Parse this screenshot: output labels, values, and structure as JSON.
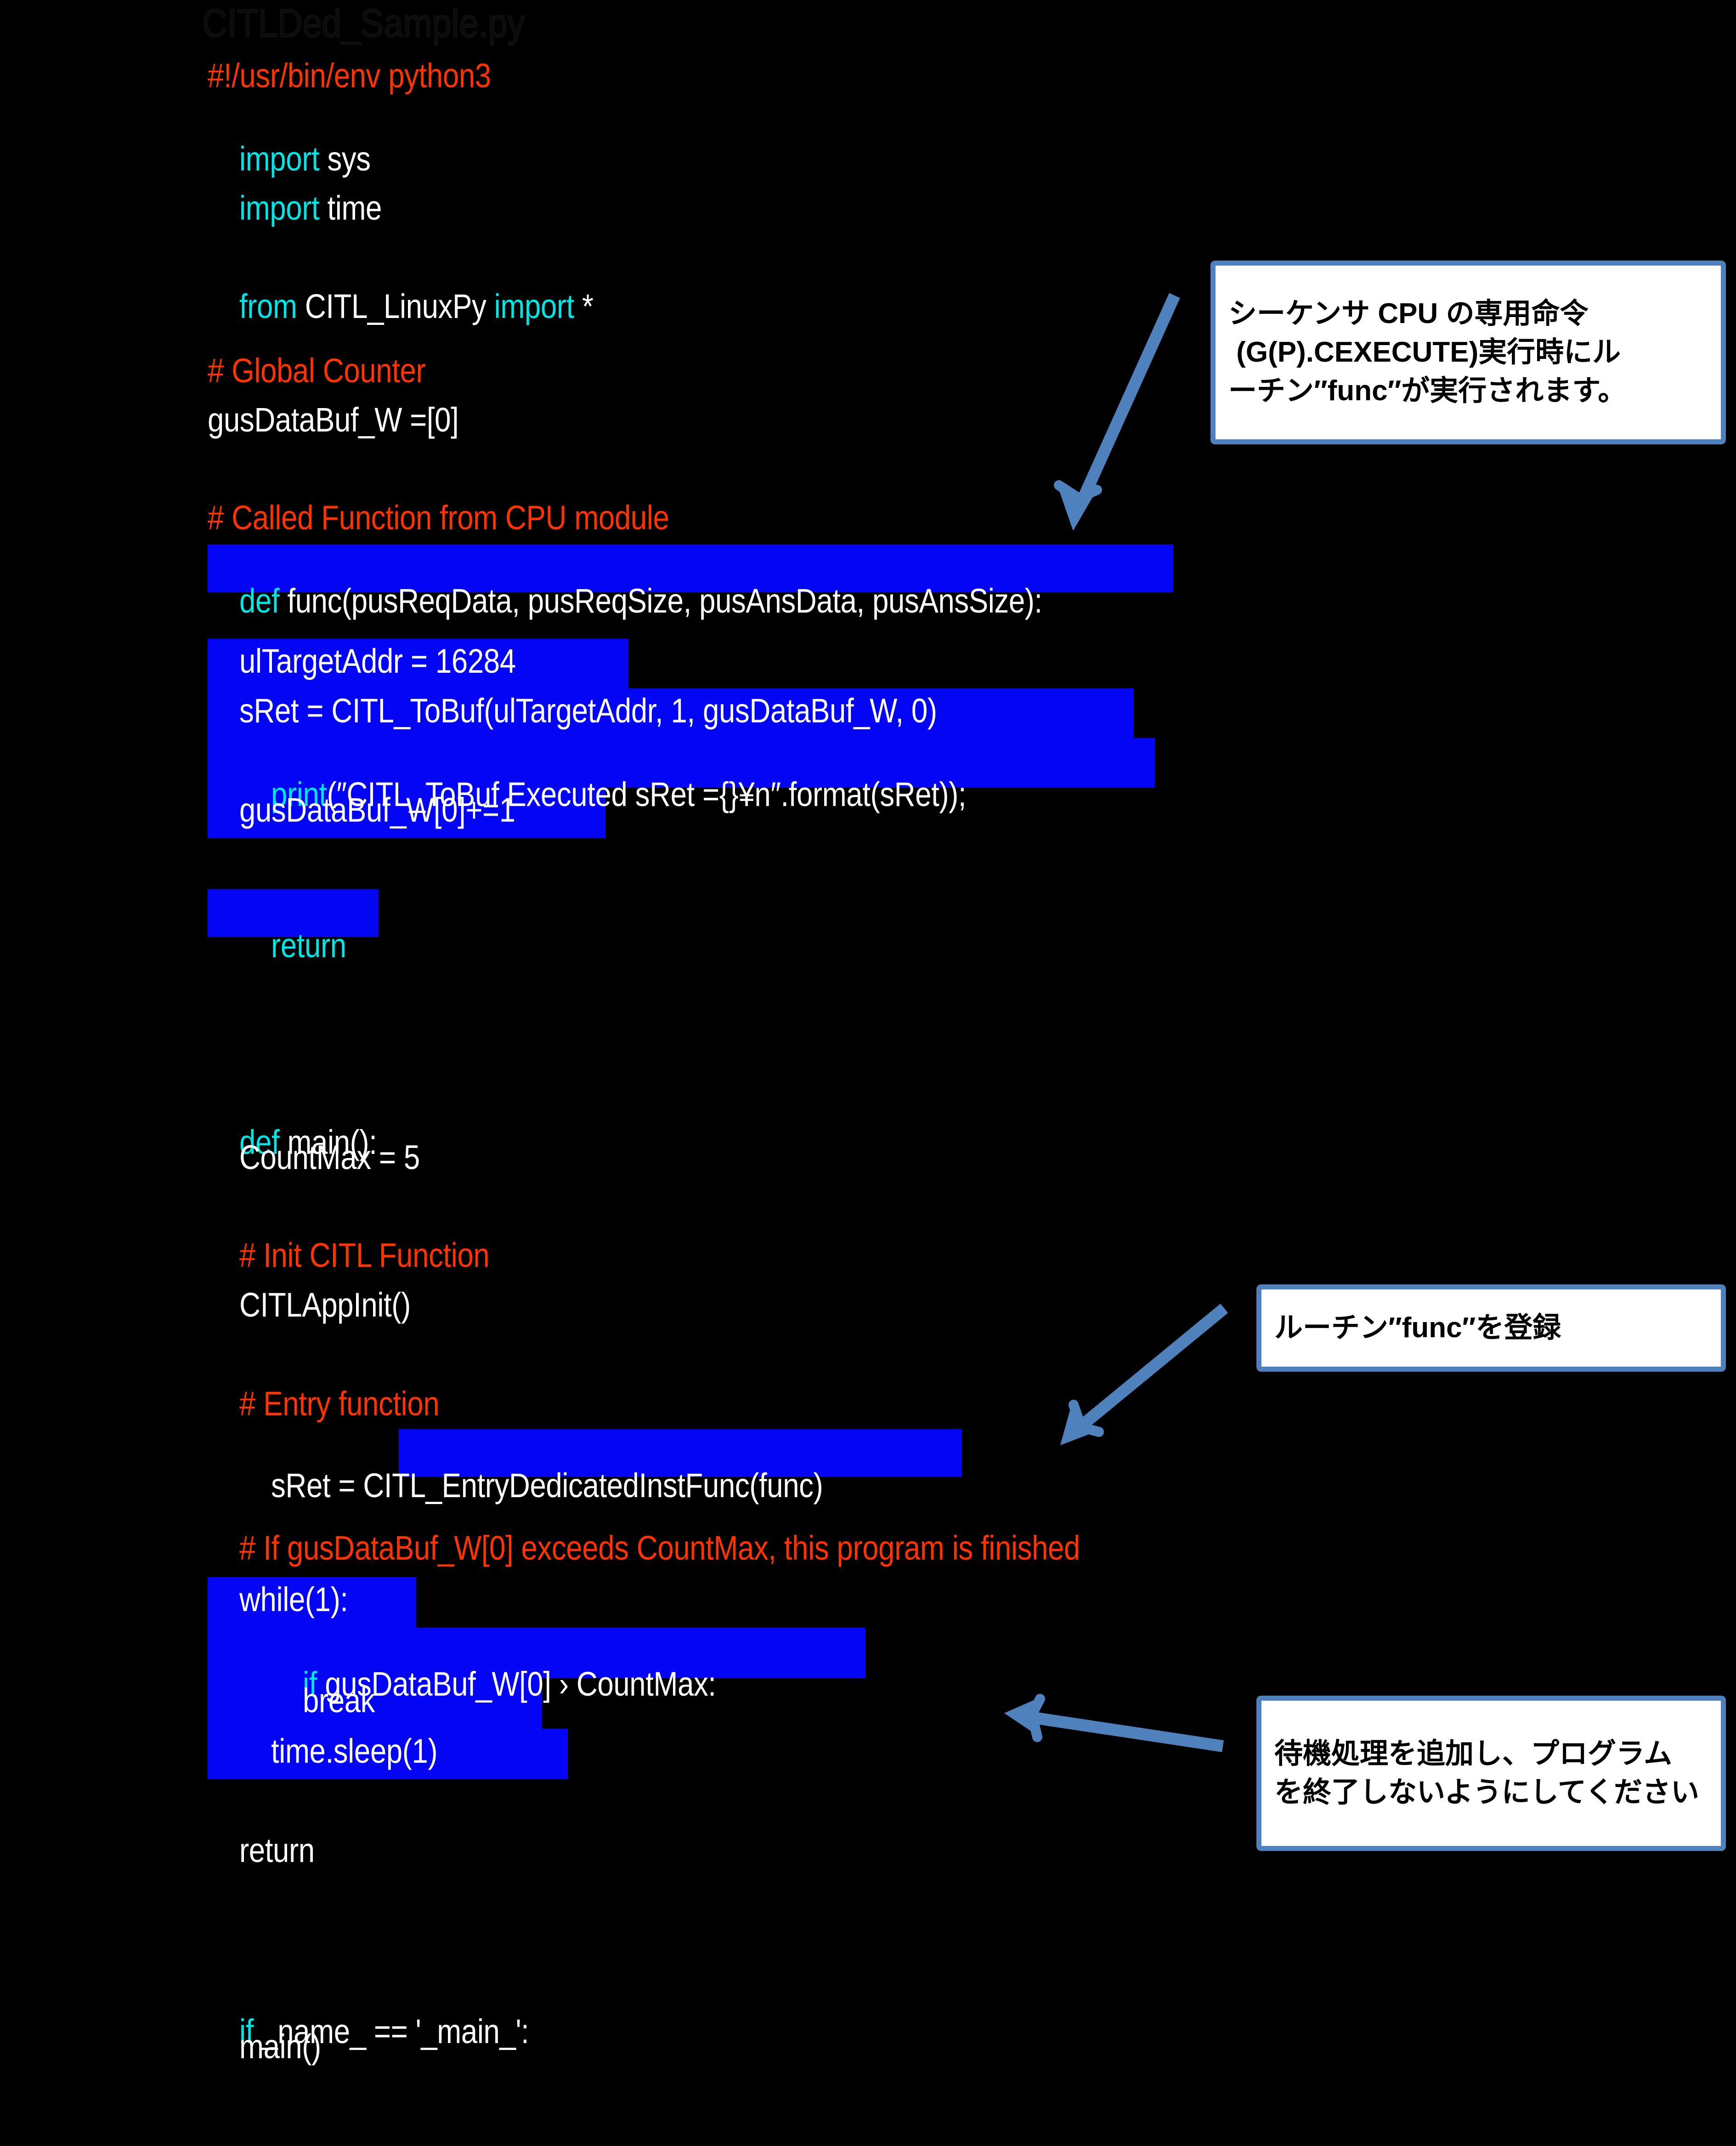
{
  "document": {
    "file_title": "CITLDed_Sample.py",
    "background_color": "#000000",
    "highlight_color": "#0505F5",
    "keyword_color": "#00E5E5",
    "comment_color": "#FF3300",
    "text_color": "#FFFFFF",
    "callout_border_color": "#4F81BD",
    "arrow_color": "#4F81BD"
  },
  "code": {
    "lines": [
      {
        "id": "shebang",
        "text": "#!/usr/bin/env python3",
        "kind": "comment"
      },
      {
        "id": "import-sys",
        "kw": "import",
        "rest": " sys",
        "kind": "kw-rest"
      },
      {
        "id": "import-time",
        "kw": "import",
        "rest": " time",
        "kind": "kw-rest"
      },
      {
        "id": "from-citl",
        "kw": "from",
        "mid": " CITL_LinuxPy ",
        "kw2": "import",
        "rest": " *",
        "kind": "from-import"
      },
      {
        "id": "comment-global",
        "text": "# Global Counter",
        "kind": "comment"
      },
      {
        "id": "gusdatabuf-init",
        "text": "gusDataBuf_W =[0]",
        "kind": "plain"
      },
      {
        "id": "comment-called",
        "text": "# Called Function from CPU module",
        "kind": "comment"
      },
      {
        "id": "def-func",
        "kw": "def",
        "rest": " func(pusReqData, pusReqSize, pusAnsData, pusAnsSize):",
        "kind": "kw-rest-hl"
      },
      {
        "id": "ultargetaddr",
        "text": "    ulTargetAddr = 16284",
        "kind": "plain-hl"
      },
      {
        "id": "sret-tobuf",
        "text": "    sRet = CITL_ToBuf(ulTargetAddr, 1, gusDataBuf_W, 0)",
        "kind": "plain-hl"
      },
      {
        "id": "print-tobuf",
        "kw": "print",
        "rest": "(″CITL_ToBuf Executed sRet ={}¥n″.format(sRet));",
        "indent": "    ",
        "kind": "kw-rest-hl"
      },
      {
        "id": "increment",
        "text": "    gusDataBuf_W[0]+=1",
        "kind": "plain-hl"
      },
      {
        "id": "func-return",
        "kw": "    return",
        "rest": "",
        "kind": "kw-rest-hl"
      },
      {
        "id": "def-main",
        "kw": "def",
        "rest": " main():",
        "kind": "kw-rest"
      },
      {
        "id": "countmax",
        "text": "    CountMax = 5",
        "kind": "plain"
      },
      {
        "id": "comment-init",
        "text": "    # Init CITL Function",
        "kind": "comment"
      },
      {
        "id": "citlappinit",
        "text": "    CITLAppInit()",
        "kind": "plain"
      },
      {
        "id": "comment-entry",
        "text": "    # Entry function",
        "kind": "comment"
      },
      {
        "id": "sret-entry",
        "pre": "    sRet = ",
        "hl": "CITL_EntryDedicatedInstFunc(func)",
        "kind": "plain-partial-hl"
      },
      {
        "id": "comment-if",
        "text": "    # If gusDataBuf_W[0] exceeds CountMax, this program is finished",
        "kind": "comment"
      },
      {
        "id": "while-1",
        "text": "    while(1):",
        "kind": "plain-hl"
      },
      {
        "id": "if-exceeds",
        "kw": "        if",
        "rest": " gusDataBuf_W[0] › CountMax:",
        "kind": "kw-rest-hl"
      },
      {
        "id": "break",
        "text": "            break",
        "kind": "plain-hl"
      },
      {
        "id": "timesleep",
        "text": "        time.sleep(1)",
        "kind": "plain-hl"
      },
      {
        "id": "main-return",
        "text": "    return",
        "kind": "plain"
      },
      {
        "id": "if-name-main",
        "kw": "if",
        "rest": " _name_ == '_main_':",
        "kind": "kw-rest"
      },
      {
        "id": "call-main",
        "text": "    main()",
        "kind": "plain"
      }
    ]
  },
  "callouts": [
    {
      "id": "callout-cexecute",
      "lines": [
        {
          "text": "シーケンサ CPU の専用命令",
          "mono": false
        },
        {
          "text": " (G(P).CEXECUTE)実行時にル",
          "mono": false
        },
        {
          "text": "ーチン″func″が実行されます。",
          "mono": false
        }
      ]
    },
    {
      "id": "callout-register-func",
      "lines": [
        {
          "text": "ルーチン″func″を登録",
          "mono": false
        }
      ]
    },
    {
      "id": "callout-wait-process",
      "lines": [
        {
          "text": "待機処理を追加し、プログラム",
          "mono": false
        },
        {
          "text": "を終了しないようにしてください",
          "mono": false
        }
      ]
    }
  ]
}
